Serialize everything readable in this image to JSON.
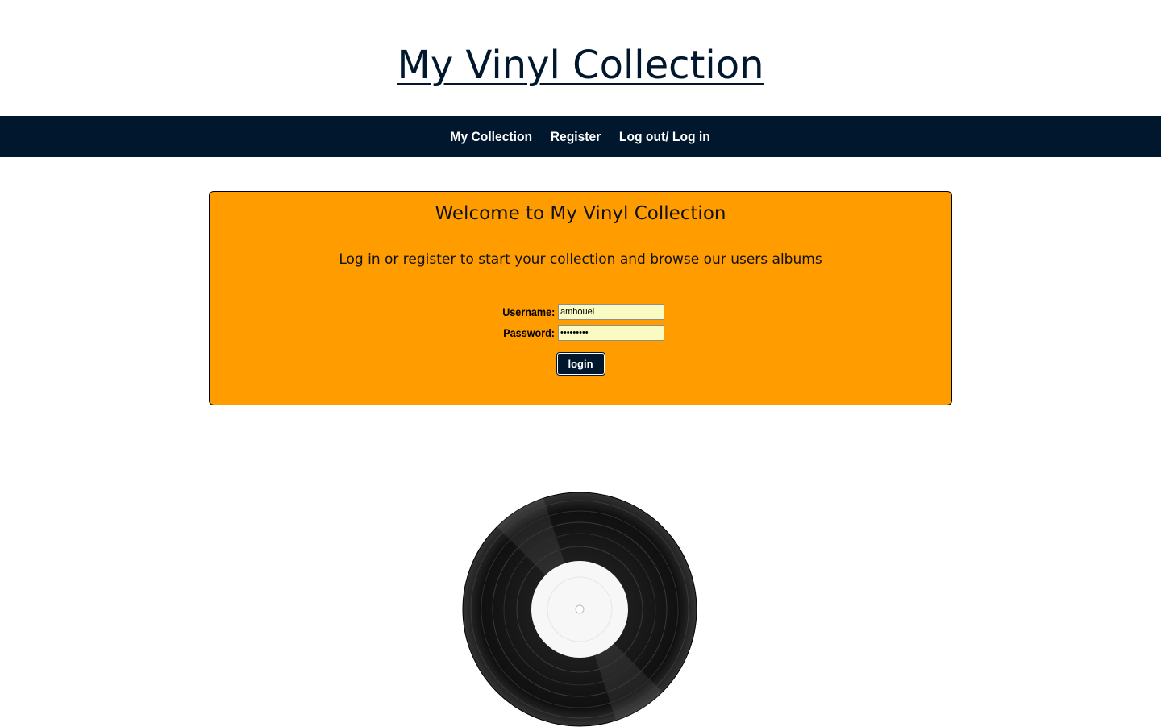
{
  "header": {
    "title": "My Vinyl Collection"
  },
  "nav": {
    "items": [
      "My Collection",
      "Register",
      "Log out/ Log in"
    ]
  },
  "panel": {
    "heading": "Welcome to My Vinyl Collection",
    "subtitle": "Log in or register to start your collection and browse our users albums",
    "username_label": "Username:",
    "username_value": "amhouel",
    "password_label": "Password:",
    "password_value": "•••••••••",
    "login_label": "login"
  },
  "colors": {
    "brand_dark": "#00172e",
    "panel_bg": "#ff9c00",
    "input_bg": "#fafbc2"
  },
  "image": {
    "icon": "vinyl-record-icon"
  }
}
